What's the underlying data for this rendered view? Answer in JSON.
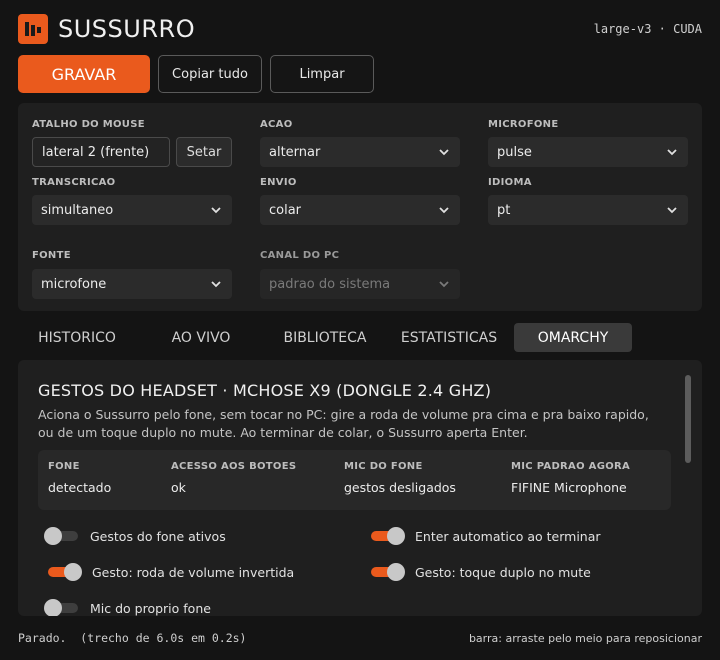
{
  "header": {
    "app_title": "SUSSURRO",
    "model_info": "large-v3 · CUDA",
    "logo_icon": "waveform-bars-icon",
    "accent_color": "#ea5a1d"
  },
  "actions": {
    "record_label": "GRAVAR",
    "copy_all_label": "Copiar tudo",
    "clear_label": "Limpar"
  },
  "settings": {
    "mouse_shortcut": {
      "label": "ATALHO DO MOUSE",
      "value": "lateral 2 (frente)",
      "set_label": "Setar"
    },
    "action": {
      "label": "ACAO",
      "value": "alternar"
    },
    "microphone": {
      "label": "MICROFONE",
      "value": "pulse"
    },
    "transcription": {
      "label": "TRANSCRICAO",
      "value": "simultaneo"
    },
    "send": {
      "label": "ENVIO",
      "value": "colar"
    },
    "language": {
      "label": "IDIOMA",
      "value": "pt"
    },
    "source": {
      "label": "FONTE",
      "value": "microfone"
    },
    "pc_channel": {
      "label": "CANAL DO PC",
      "value": "padrao do sistema",
      "disabled": true
    }
  },
  "tabs": [
    {
      "label": "HISTORICO",
      "active": false
    },
    {
      "label": "AO VIVO",
      "active": false
    },
    {
      "label": "BIBLIOTECA",
      "active": false
    },
    {
      "label": "ESTATISTICAS",
      "active": false
    },
    {
      "label": "OMARCHY",
      "active": true
    }
  ],
  "panel": {
    "title": "GESTOS DO HEADSET · MCHOSE X9 (DONGLE 2.4 GHZ)",
    "description": "Aciona o Sussurro pelo fone, sem tocar no PC: gire a roda de volume pra cima e pra baixo rapido, ou de um toque duplo no mute. Ao terminar de colar, o Sussurro aperta Enter.",
    "info": [
      {
        "label": "FONE",
        "value": "detectado"
      },
      {
        "label": "ACESSO AOS BOTOES",
        "value": "ok"
      },
      {
        "label": "MIC DO FONE",
        "value": "gestos desligados"
      },
      {
        "label": "MIC PADRAO AGORA",
        "value": "FIFINE Microphone"
      }
    ],
    "toggles": [
      {
        "label": "Gestos do fone ativos",
        "on": false
      },
      {
        "label": "Enter automatico ao terminar",
        "on": true
      },
      {
        "label": "Gesto: roda de volume invertida",
        "on": true
      },
      {
        "label": "Gesto: toque duplo no mute",
        "on": true
      },
      {
        "label": "Mic do proprio fone",
        "on": false
      }
    ]
  },
  "footer": {
    "status": "Parado.  (trecho de 6.0s em 0.2s)",
    "hint": "barra: arraste pelo meio para reposicionar"
  }
}
